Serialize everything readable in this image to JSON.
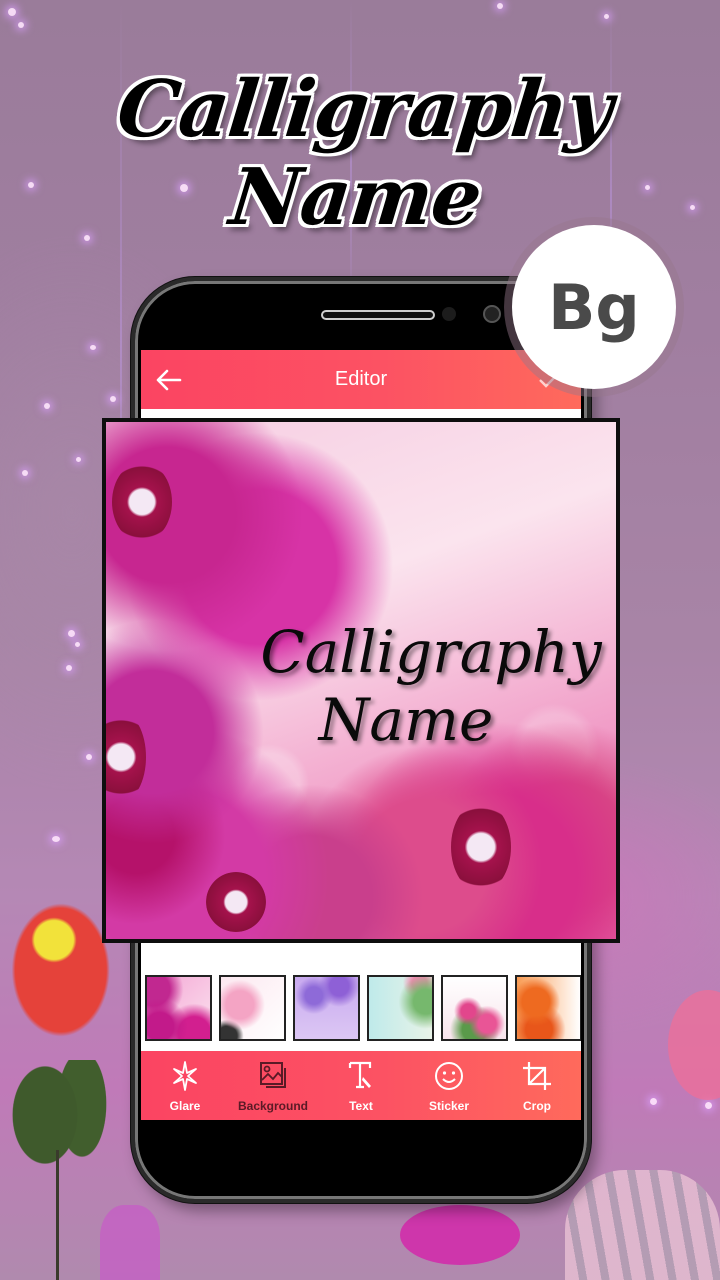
{
  "promo": {
    "headline_line1": "Calligraphy",
    "headline_line2": "Name",
    "badge_text": "Bg"
  },
  "app_bar": {
    "back_icon": "arrow-left-icon",
    "title": "Editor",
    "done_icon": "check-icon"
  },
  "preview": {
    "text_line1": "Calligraphy",
    "text_line2": "Name",
    "background_theme": "pink orchids"
  },
  "backgrounds": [
    {
      "name": "pink-orchids",
      "selected": true
    },
    {
      "name": "pink-lily"
    },
    {
      "name": "purple-orchids"
    },
    {
      "name": "pastel-blossoms"
    },
    {
      "name": "pink-roses"
    },
    {
      "name": "orange-lilies"
    }
  ],
  "toolbar": {
    "items": [
      {
        "label": "Glare",
        "icon": "sparkle-icon"
      },
      {
        "label": "Background",
        "icon": "image-icon",
        "active": true
      },
      {
        "label": "Text",
        "icon": "text-icon"
      },
      {
        "label": "Sticker",
        "icon": "smiley-icon"
      },
      {
        "label": "Crop",
        "icon": "crop-icon"
      }
    ]
  },
  "colors": {
    "accent_start": "#fb4462",
    "accent_end": "#ff6a5c",
    "active_label": "#5a1a26"
  }
}
